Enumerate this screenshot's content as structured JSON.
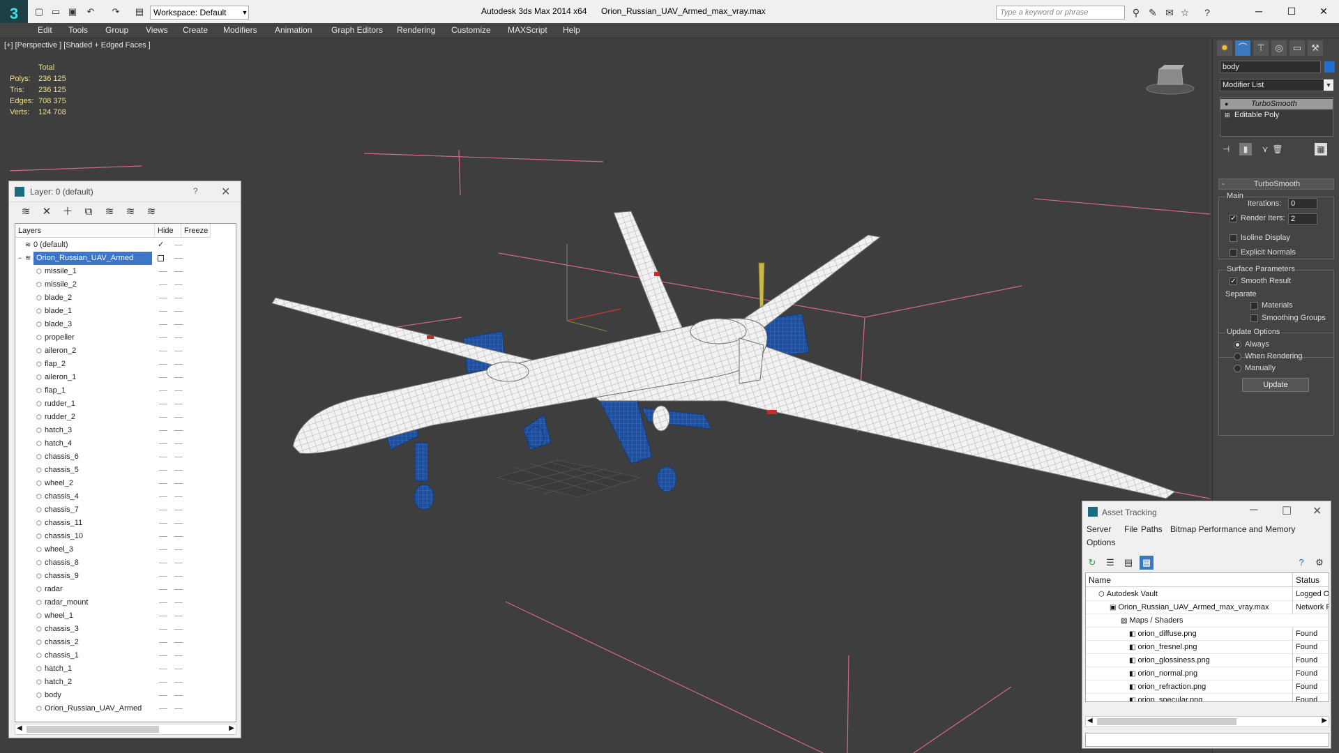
{
  "titlebar": {
    "app_title": "Autodesk 3ds Max  2014 x64",
    "file_title": "Orion_Russian_UAV_Armed_max_vray.max",
    "workspace": "Workspace: Default",
    "search_placeholder": "Type a keyword or phrase"
  },
  "menu": [
    "Edit",
    "Tools",
    "Group",
    "Views",
    "Create",
    "Modifiers",
    "Animation",
    "Graph Editors",
    "Rendering",
    "Customize",
    "MAXScript",
    "Help"
  ],
  "viewport": {
    "label": "[+] [Perspective ] [Shaded + Edged Faces ]",
    "stats": {
      "header": "Total",
      "rows": [
        {
          "label": "Polys:",
          "value": "236 125"
        },
        {
          "label": "Tris:",
          "value": "236 125"
        },
        {
          "label": "Edges:",
          "value": "708 375"
        },
        {
          "label": "Verts:",
          "value": "124 708"
        }
      ]
    }
  },
  "layer_explorer": {
    "title": "Layer: 0 (default)",
    "help": "?",
    "columns": {
      "layers": "Layers",
      "hide": "Hide",
      "freeze": "Freeze"
    },
    "default_layer": "0 (default)",
    "selected_layer": "Orion_Russian_UAV_Armed",
    "objects": [
      "missile_1",
      "missile_2",
      "blade_2",
      "blade_1",
      "blade_3",
      "propeller",
      "aileron_2",
      "flap_2",
      "aileron_1",
      "flap_1",
      "rudder_1",
      "rudder_2",
      "hatch_3",
      "hatch_4",
      "chassis_6",
      "chassis_5",
      "wheel_2",
      "chassis_4",
      "chassis_7",
      "chassis_11",
      "chassis_10",
      "wheel_3",
      "chassis_8",
      "chassis_9",
      "radar",
      "radar_mount",
      "wheel_1",
      "chassis_3",
      "chassis_2",
      "chassis_1",
      "hatch_1",
      "hatch_2",
      "body",
      "Orion_Russian_UAV_Armed"
    ]
  },
  "command_panel": {
    "object_name": "body",
    "object_color": "#1f6fd1",
    "modifier_list": "Modifier List",
    "stack": [
      "TurboSmooth",
      "Editable Poly"
    ],
    "turbosmooth": {
      "title": "TurboSmooth",
      "main": "Main",
      "iterations_label": "Iterations:",
      "iterations": "0",
      "render_iters_label": "Render Iters:",
      "render_iters": "2",
      "isoline": "Isoline Display",
      "explicit": "Explicit Normals",
      "surface": "Surface Parameters",
      "smooth_result": "Smooth Result",
      "separate": "Separate",
      "materials": "Materials",
      "smoothing_groups": "Smoothing Groups",
      "update_options": "Update Options",
      "always": "Always",
      "when_rendering": "When Rendering",
      "manually": "Manually",
      "update": "Update"
    }
  },
  "asset_tracking": {
    "title": "Asset Tracking",
    "menu": [
      "Server",
      "File",
      "Paths",
      "Bitmap Performance and Memory",
      "Options"
    ],
    "columns": {
      "name": "Name",
      "status": "Status"
    },
    "rows": [
      {
        "name": "Autodesk Vault",
        "status": "Logged O"
      },
      {
        "name": "Orion_Russian_UAV_Armed_max_vray.max",
        "status": "Network F"
      },
      {
        "name": "Maps / Shaders",
        "status": ""
      },
      {
        "name": "orion_diffuse.png",
        "status": "Found"
      },
      {
        "name": "orion_fresnel.png",
        "status": "Found"
      },
      {
        "name": "orion_glossiness.png",
        "status": "Found"
      },
      {
        "name": "orion_normal.png",
        "status": "Found"
      },
      {
        "name": "orion_refraction.png",
        "status": "Found"
      },
      {
        "name": "orion_specular.png",
        "status": "Found"
      }
    ]
  }
}
